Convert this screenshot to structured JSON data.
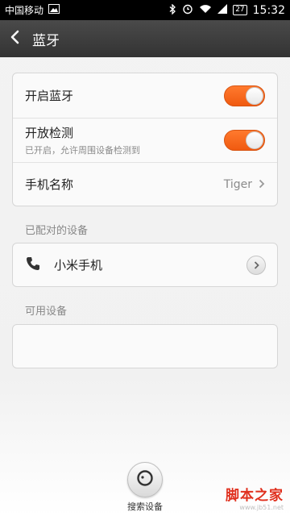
{
  "status_bar": {
    "carrier": "中国移动",
    "battery": "27",
    "time": "15:32"
  },
  "header": {
    "title": "蓝牙"
  },
  "settings": {
    "bluetooth_label": "开启蓝牙",
    "bluetooth_on": true,
    "visible_label": "开放检测",
    "visible_sub": "已开启，允许周围设备检测到",
    "visible_on": true,
    "phone_name_label": "手机名称",
    "phone_name_value": "Tiger"
  },
  "paired": {
    "section_title": "已配对的设备",
    "devices": [
      {
        "name": "小米手机"
      }
    ]
  },
  "available": {
    "section_title": "可用设备"
  },
  "search": {
    "label": "搜索设备"
  },
  "watermark": {
    "line1": "脚本之家",
    "line2": "www.jb51.net"
  },
  "colors": {
    "accent": "#f26a1b",
    "header": "#3d3d3d"
  }
}
